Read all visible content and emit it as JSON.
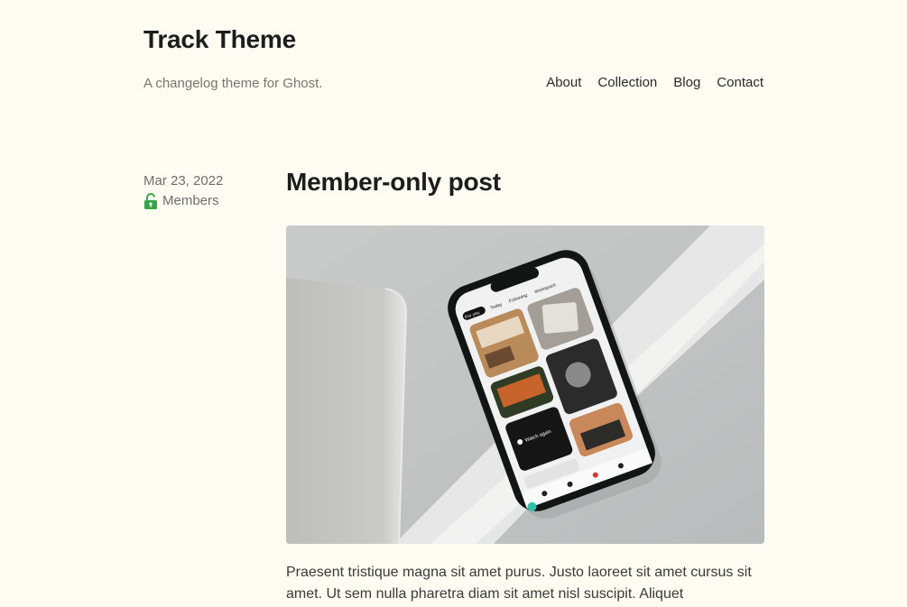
{
  "site": {
    "title": "Track Theme",
    "description": "A changelog theme for Ghost."
  },
  "nav": {
    "items": [
      {
        "label": "About"
      },
      {
        "label": "Collection"
      },
      {
        "label": "Blog"
      },
      {
        "label": "Contact"
      }
    ]
  },
  "post": {
    "date": "Mar 23, 2022",
    "access": "Members",
    "access_icon": "unlock-icon",
    "access_color": "#3aa44a",
    "title": "Member-only post",
    "image_subject": "smartphone-on-desk-photo",
    "image_phone_text": {
      "tab_for_you": "For you",
      "tab_today": "Today",
      "tab_following": "Following",
      "tab_workspace": "Workspace",
      "overlay": "Watch again"
    },
    "excerpt": "Praesent tristique magna sit amet purus. Justo laoreet sit amet cursus sit amet. Ut sem nulla pharetra diam sit amet nisl suscipit. Aliquet"
  },
  "colors": {
    "background": "#fffcf3",
    "text": "#1d1d1b",
    "muted": "#77776f"
  }
}
